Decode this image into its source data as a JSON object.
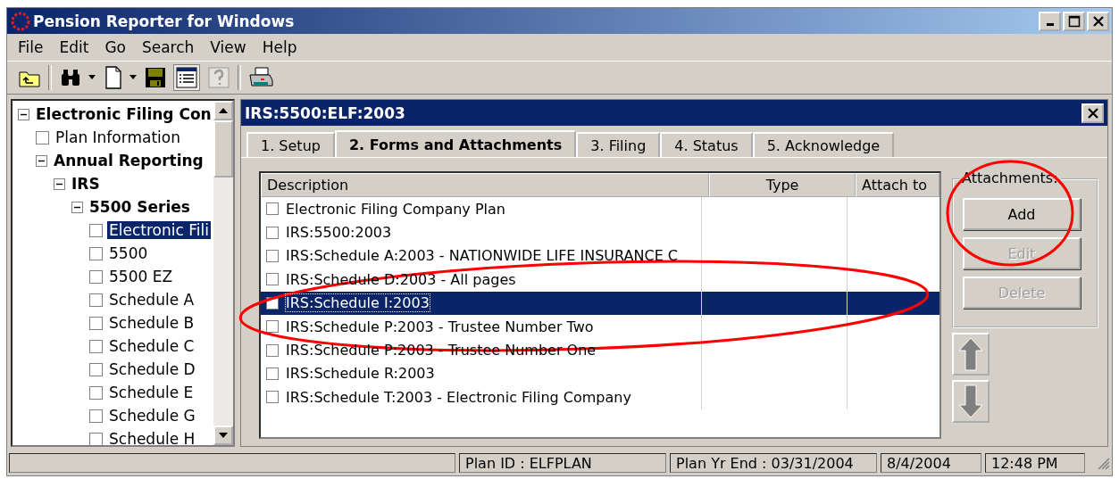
{
  "window": {
    "title": "Pension Reporter for Windows"
  },
  "menu": [
    "File",
    "Edit",
    "Go",
    "Search",
    "View",
    "Help"
  ],
  "tree": [
    {
      "label": "Electronic Filing Con",
      "bold": true,
      "expanded": true,
      "selected": false,
      "children": [
        {
          "label": "Plan Information",
          "bold": false,
          "selected": false
        },
        {
          "label": "Annual Reporting",
          "bold": true,
          "expanded": true,
          "selected": false,
          "children": [
            {
              "label": "IRS",
              "bold": true,
              "expanded": true,
              "selected": false,
              "children": [
                {
                  "label": "5500 Series",
                  "bold": true,
                  "expanded": true,
                  "selected": false,
                  "children": [
                    {
                      "label": "Electronic Fili",
                      "bold": false,
                      "selected": true
                    },
                    {
                      "label": "5500",
                      "bold": false,
                      "selected": false
                    },
                    {
                      "label": "5500 EZ",
                      "bold": false,
                      "selected": false
                    },
                    {
                      "label": "Schedule A",
                      "bold": false,
                      "selected": false
                    },
                    {
                      "label": "Schedule B",
                      "bold": false,
                      "selected": false
                    },
                    {
                      "label": "Schedule C",
                      "bold": false,
                      "selected": false
                    },
                    {
                      "label": "Schedule D",
                      "bold": false,
                      "selected": false
                    },
                    {
                      "label": "Schedule E",
                      "bold": false,
                      "selected": false
                    },
                    {
                      "label": "Schedule G",
                      "bold": false,
                      "selected": false
                    },
                    {
                      "label": "Schedule H",
                      "bold": false,
                      "selected": false
                    }
                  ]
                }
              ]
            }
          ]
        }
      ]
    }
  ],
  "panel": {
    "title": "IRS:5500:ELF:2003"
  },
  "tabs": [
    {
      "label": "1. Setup",
      "selected": false
    },
    {
      "label": "2. Forms and Attachments",
      "selected": true
    },
    {
      "label": "3. Filing",
      "selected": false
    },
    {
      "label": "4. Status",
      "selected": false
    },
    {
      "label": "5. Acknowledge",
      "selected": false
    }
  ],
  "table": {
    "columns": [
      "Description",
      "Type",
      "Attach to"
    ],
    "rows": [
      {
        "description": "Electronic Filing Company Plan",
        "checked": false,
        "selected": false
      },
      {
        "description": "IRS:5500:2003",
        "checked": false,
        "selected": false
      },
      {
        "description": "IRS:Schedule A:2003 - NATIONWIDE LIFE INSURANCE C",
        "checked": false,
        "selected": false
      },
      {
        "description": "IRS:Schedule D:2003 - All pages",
        "checked": false,
        "selected": false
      },
      {
        "description": "IRS:Schedule I:2003",
        "checked": false,
        "selected": true
      },
      {
        "description": "IRS:Schedule P:2003 - Trustee Number Two",
        "checked": false,
        "selected": false
      },
      {
        "description": "IRS:Schedule P:2003 - Trustee Number One",
        "checked": false,
        "selected": false
      },
      {
        "description": "IRS:Schedule R:2003",
        "checked": false,
        "selected": false
      },
      {
        "description": "IRS:Schedule T:2003 - Electronic Filing Company",
        "checked": false,
        "selected": false
      }
    ]
  },
  "attachments": {
    "title": "Attachments:",
    "buttons": [
      {
        "label": "Add",
        "disabled": false
      },
      {
        "label": "Edit",
        "disabled": true
      },
      {
        "label": "Delete",
        "disabled": true
      }
    ]
  },
  "status_bar": [
    "Plan ID : ELFPLAN",
    "Plan Yr End : 03/31/2004",
    "8/4/2004",
    "12:48 PM"
  ]
}
